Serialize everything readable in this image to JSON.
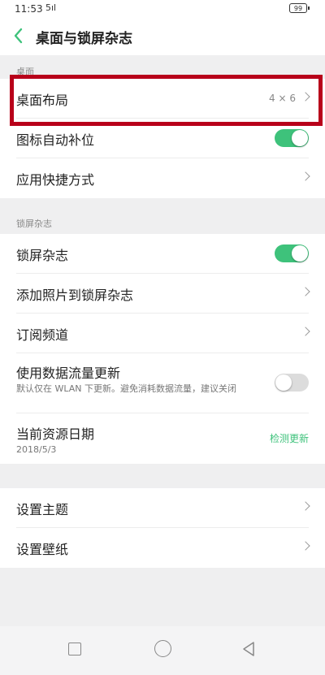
{
  "status_bar": {
    "time": "11:53",
    "signal_text": "5ıl",
    "battery": "99"
  },
  "header": {
    "title": "桌面与锁屏杂志"
  },
  "sections": {
    "desktop_label": "桌面",
    "lockscreen_label": "锁屏杂志"
  },
  "desktop": {
    "layout": {
      "label": "桌面布局",
      "value": "4 × 6"
    },
    "auto_fill": {
      "label": "图标自动补位",
      "on": true
    },
    "shortcuts": {
      "label": "应用快捷方式"
    }
  },
  "lockscreen": {
    "magazine": {
      "label": "锁屏杂志",
      "on": true
    },
    "add_photos": {
      "label": "添加照片到锁屏杂志"
    },
    "subscribe": {
      "label": "订阅频道"
    },
    "mobile_data": {
      "label": "使用数据流量更新",
      "sub": "默认仅在 WLAN 下更新。避免消耗数据流量，建议关闭",
      "on": false
    },
    "resource_date": {
      "label": "当前资源日期",
      "date": "2018/5/3",
      "action": "检测更新"
    }
  },
  "more": {
    "theme": {
      "label": "设置主题"
    },
    "wallpaper": {
      "label": "设置壁纸"
    }
  },
  "colors": {
    "accent": "#3ec27b",
    "highlight_box": "#b8001a"
  }
}
